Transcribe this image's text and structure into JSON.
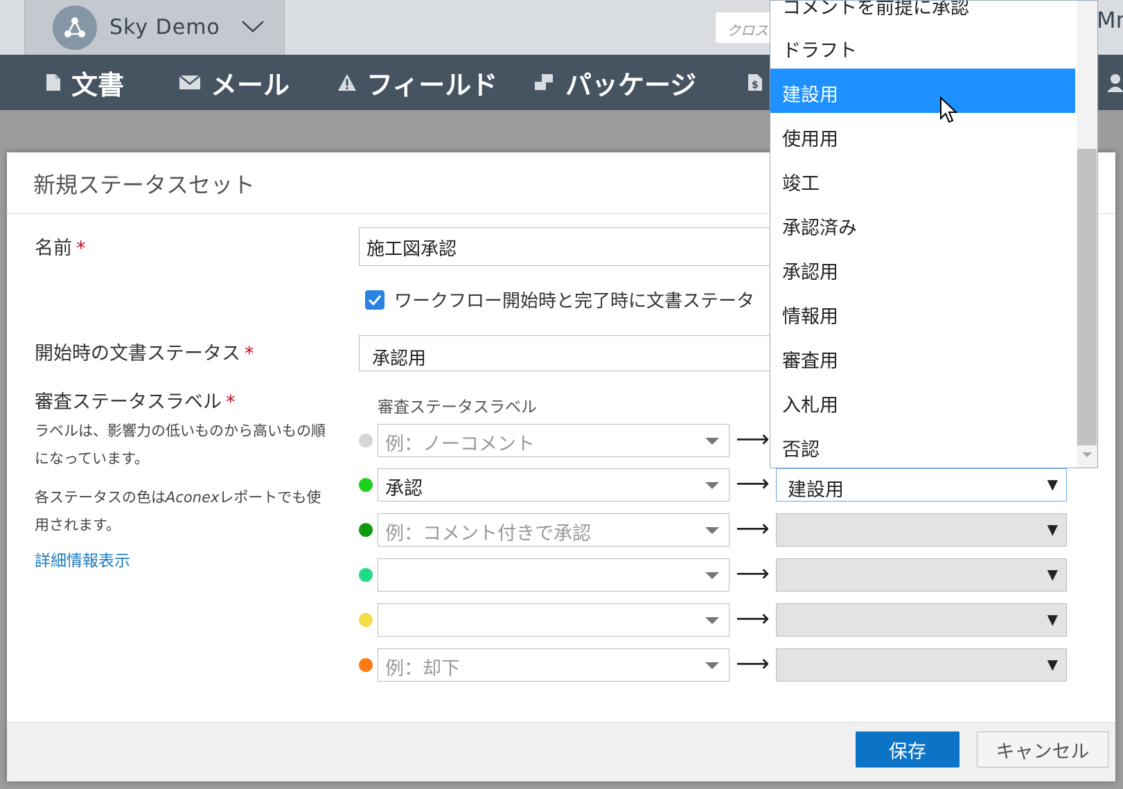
{
  "header": {
    "project_name": "Sky Demo",
    "search_placeholder": "クロス",
    "user_initial": "Mr"
  },
  "nav": {
    "items": [
      {
        "label": "文書",
        "icon": "document-icon"
      },
      {
        "label": "メール",
        "icon": "mail-icon"
      },
      {
        "label": "フィールド",
        "icon": "warning-icon"
      },
      {
        "label": "パッケージ",
        "icon": "package-icon"
      }
    ]
  },
  "modal": {
    "title": "新規ステータスセット",
    "name_label": "名前",
    "name_value": "施工図承認",
    "checkbox_label": "ワークフロー開始時と完了時に文書ステータ",
    "start_status_label": "開始時の文書ステータス",
    "start_status_value": "承認用",
    "review_label": "審査ステータスラベル",
    "help_1": "ラベルは、影響力の低いものから高いもの順になっています。",
    "help_2_pre": "各ステータスの色は",
    "help_2_brand": "Aconex",
    "help_2_post": "レポートでも使用されます。",
    "help_link": "詳細情報表示",
    "sub_header": "審査ステータスラベル",
    "required_mark": "*",
    "arrow": "⟶",
    "rows": [
      {
        "color": "#d6d6d6",
        "value": "",
        "placeholder": "例：ノーコメント",
        "status": ""
      },
      {
        "color": "#1fd11f",
        "value": "承認",
        "placeholder": "",
        "status": "建設用"
      },
      {
        "color": "#0e9a0e",
        "value": "",
        "placeholder": "例：コメント付きで承認",
        "status": ""
      },
      {
        "color": "#20dc88",
        "value": "",
        "placeholder": "",
        "status": ""
      },
      {
        "color": "#f3dc45",
        "value": "",
        "placeholder": "",
        "status": ""
      },
      {
        "color": "#ff7a12",
        "value": "",
        "placeholder": "例：却下",
        "status": ""
      }
    ],
    "save_label": "保存",
    "cancel_label": "キャンセル"
  },
  "dropdown": {
    "options": [
      "コメントを前提に承認",
      "ドラフト",
      "建設用",
      "使用用",
      "竣工",
      "承認済み",
      "承認用",
      "情報用",
      "審査用",
      "入札用",
      "否認"
    ],
    "selected": "建設用"
  },
  "colors": {
    "accent": "#1e90ff",
    "nav_bg": "#465361",
    "primary_button": "#0c74c6"
  }
}
